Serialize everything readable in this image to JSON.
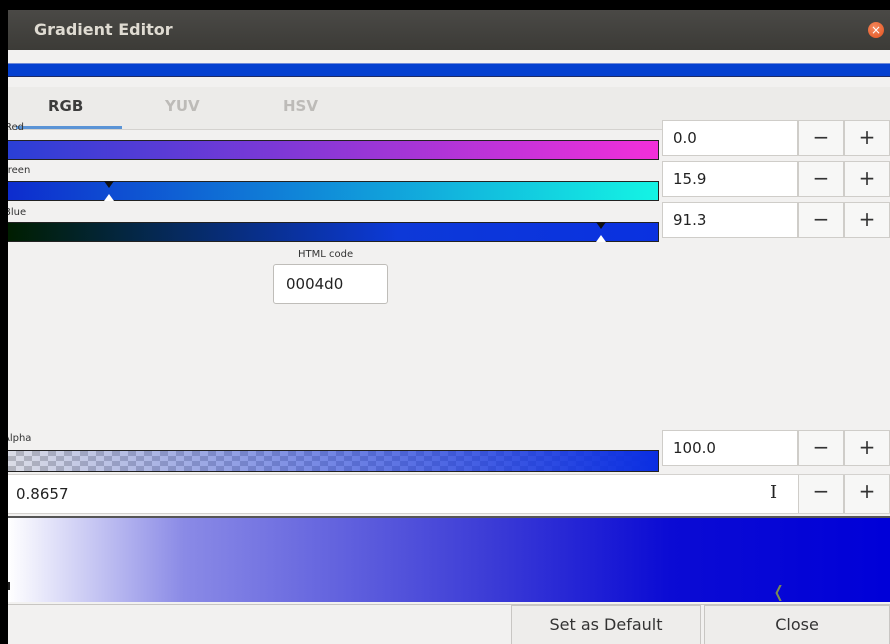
{
  "window": {
    "title": "Gradient Editor",
    "close_icon": "×"
  },
  "tabs": [
    {
      "label": "RGB",
      "active": true
    },
    {
      "label": "YUV",
      "active": false
    },
    {
      "label": "HSV",
      "active": false
    }
  ],
  "channels": {
    "red": {
      "label": "Red",
      "value": "0.0",
      "level": 0.0
    },
    "green": {
      "label": "Green",
      "value": "15.9",
      "level": 0.159
    },
    "blue": {
      "label": "Blue",
      "value": "91.3",
      "level": 0.913
    },
    "alpha": {
      "label": "Alpha",
      "value": "100.0",
      "level": 1.0
    }
  },
  "stepper": {
    "minus": "−",
    "plus": "+"
  },
  "html_code": {
    "label": "HTML code",
    "value": "0004d0"
  },
  "position": {
    "value": "0.8657",
    "cursor_icon": "I"
  },
  "buttons": {
    "set_default": "Set as Default",
    "close": "Close"
  },
  "colors": {
    "current": "#0004d0",
    "titlebar": "#3c3b37",
    "tab_accent": "#5b94d6"
  }
}
